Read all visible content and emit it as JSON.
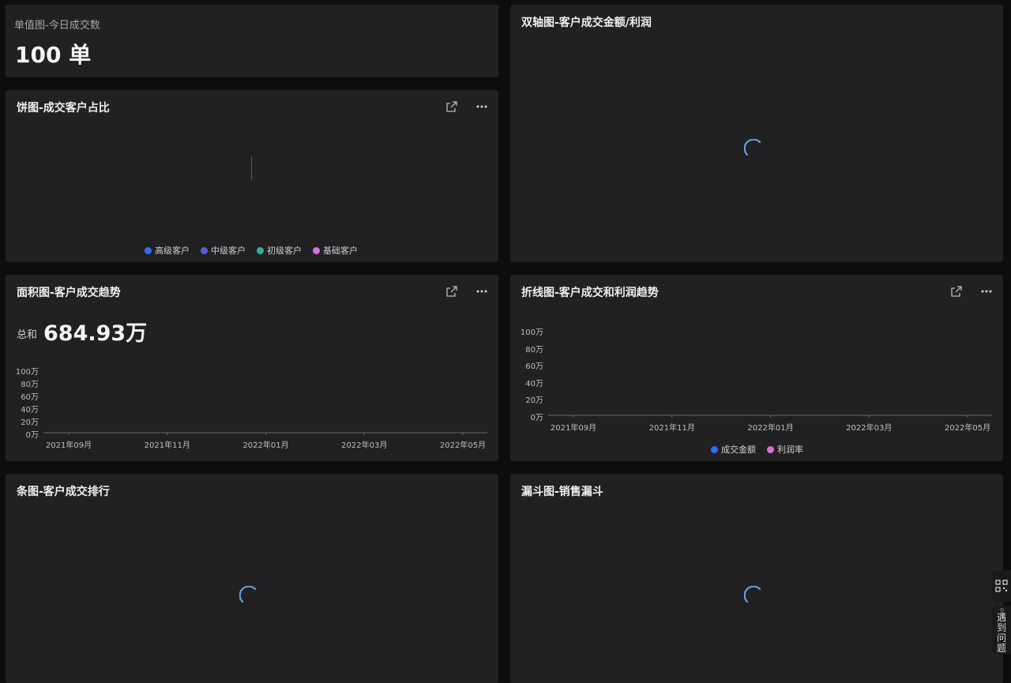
{
  "cards": {
    "single_value": {
      "title": "单值图-今日成交数",
      "value": "100 单"
    },
    "dual_axis": {
      "title": "双轴图-客户成交金额/利润"
    },
    "pie": {
      "title": "饼图-成交客户占比",
      "legend": [
        {
          "label": "高级客户",
          "color": "#2f6bff"
        },
        {
          "label": "中级客户",
          "color": "#5b5bd6"
        },
        {
          "label": "初级客户",
          "color": "#2fb3a3"
        },
        {
          "label": "基础客户",
          "color": "#d670d6"
        }
      ]
    },
    "area": {
      "title": "面积图-客户成交趋势",
      "total_label": "总和",
      "total_value": "684.93万"
    },
    "line": {
      "title": "折线图-客户成交和利润趋势",
      "legend": [
        {
          "label": "成交金额",
          "color": "#2f6bff"
        },
        {
          "label": "利润率",
          "color": "#d670d6"
        }
      ]
    },
    "bar": {
      "title": "条图-客户成交排行"
    },
    "funnel": {
      "title": "漏斗图-销售漏斗"
    }
  },
  "chart_data": [
    {
      "type": "area",
      "title": "面积图-客户成交趋势",
      "y_ticks": [
        "100万",
        "80万",
        "60万",
        "40万",
        "20万",
        "0万"
      ],
      "x_ticks": [
        "2021年09月",
        "2021年11月",
        "2022年01月",
        "2022年03月",
        "2022年05月"
      ],
      "ylim": [
        0,
        1000000
      ]
    },
    {
      "type": "line",
      "title": "折线图-客户成交和利润趋势",
      "y_ticks": [
        "100万",
        "80万",
        "60万",
        "40万",
        "20万",
        "0万"
      ],
      "x_ticks": [
        "2021年09月",
        "2021年11月",
        "2022年01月",
        "2022年03月",
        "2022年05月"
      ],
      "ylim": [
        0,
        1000000
      ],
      "series": [
        {
          "name": "成交金额"
        },
        {
          "name": "利润率"
        }
      ]
    }
  ],
  "side_panel": {
    "top_icon": "qr-code-icon",
    "help_icon": "question-icon",
    "help_label": "遇到问题"
  },
  "colors": {
    "card_bg": "#212123",
    "page_bg": "#0d0d0f",
    "spinner": "#6aa0d8"
  }
}
